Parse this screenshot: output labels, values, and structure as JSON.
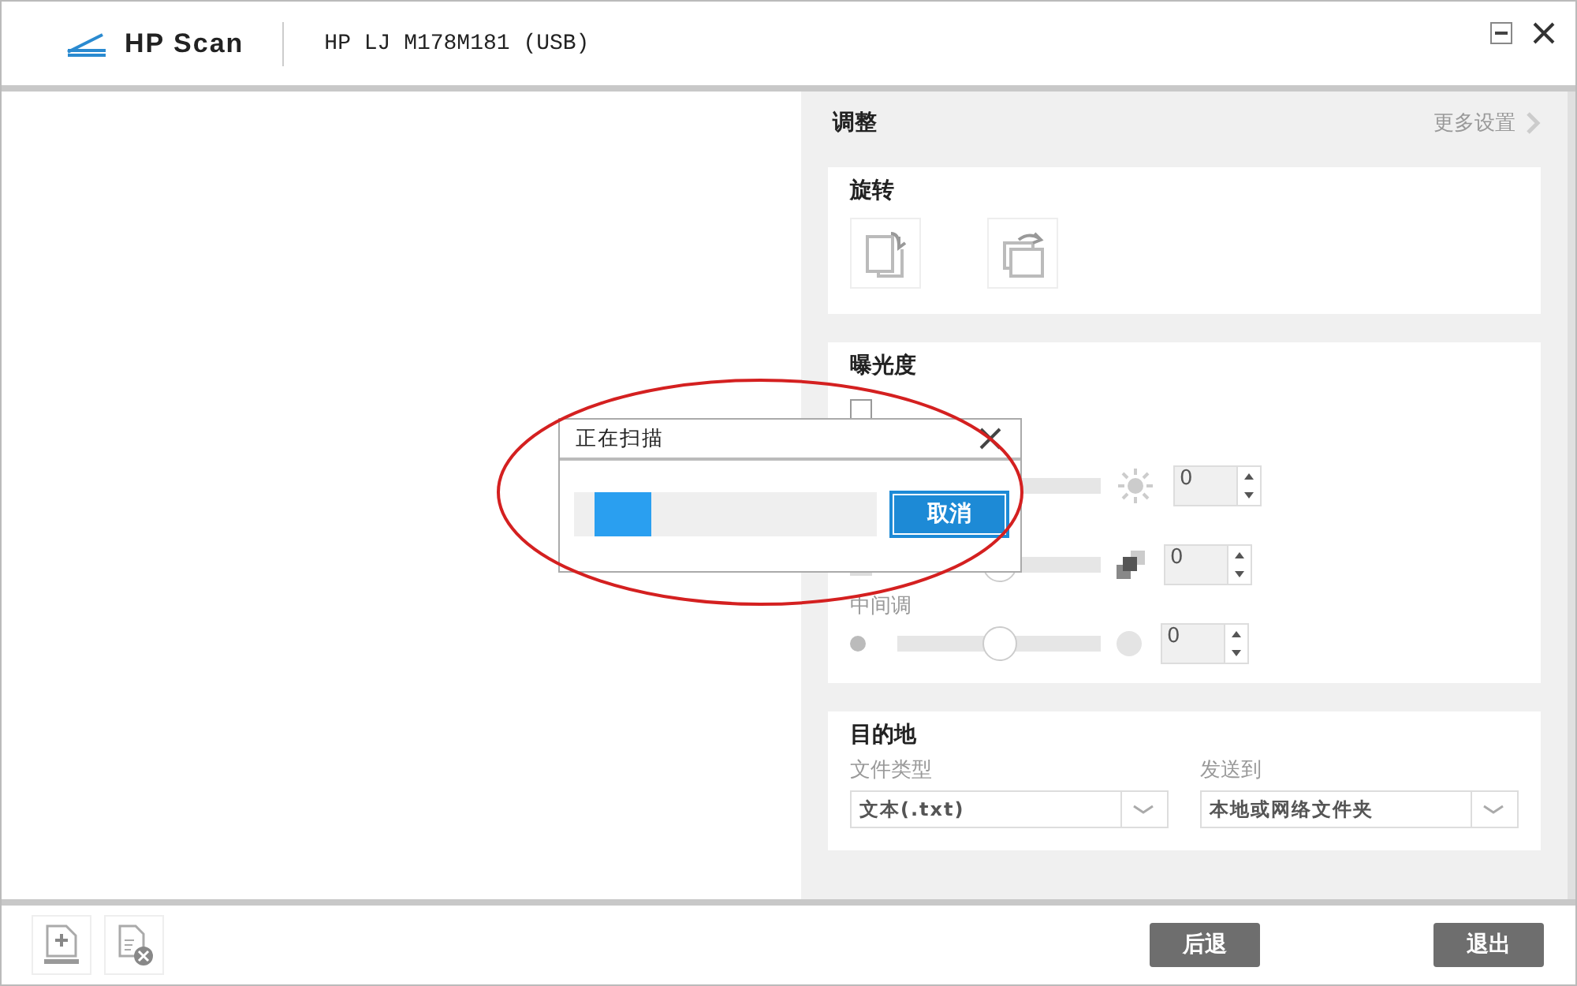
{
  "app": {
    "title": "HP Scan",
    "device": "HP LJ M178M181 (USB)"
  },
  "panel": {
    "title": "调整",
    "more_link": "更多设置"
  },
  "rotate": {
    "title": "旋转"
  },
  "exposure": {
    "title": "曝光度",
    "auto": {
      "checked": false
    },
    "sliders": [
      {
        "kind": "brightness",
        "value": "0"
      },
      {
        "kind": "contrast",
        "level": 0.5,
        "value": "0"
      },
      {
        "kind": "midtone",
        "label": "中间调",
        "level": 0.5,
        "value": "0"
      }
    ]
  },
  "destination": {
    "title": "目的地",
    "fields": [
      {
        "label": "文件类型",
        "value": "文本(.txt)"
      },
      {
        "label": "发送到",
        "value": "本地或网络文件夹"
      }
    ]
  },
  "dialog": {
    "title": "正在扫描",
    "level": 0.2,
    "button": "取消"
  },
  "footer": {
    "buttons": [
      "后退",
      "退出"
    ]
  }
}
